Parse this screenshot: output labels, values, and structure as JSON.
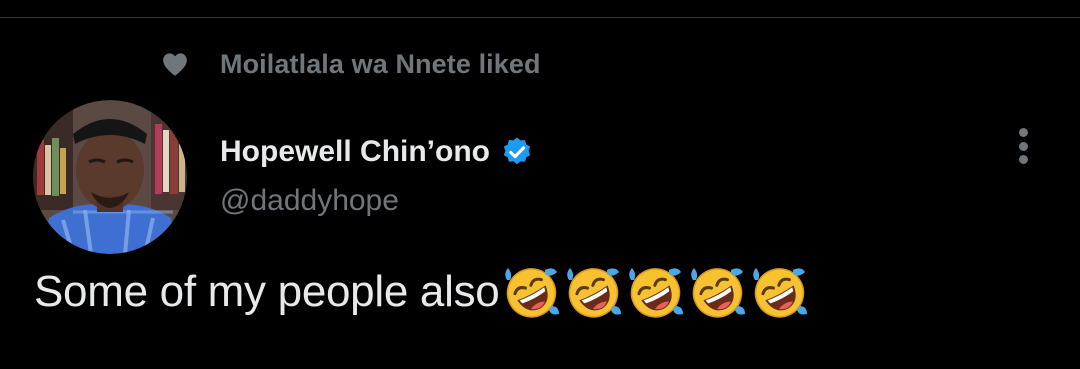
{
  "social_context": {
    "icon": "heart-icon",
    "text": "Moilatlala wa Nnete liked"
  },
  "tweet": {
    "author": {
      "display_name": "Hopewell Chin’ono",
      "handle": "@daddyhope",
      "verified": true,
      "verified_color": "#1d9bf0"
    },
    "text": "Some of my people also",
    "emojis": [
      "🤣",
      "🤣",
      "🤣",
      "🤣",
      "🤣"
    ]
  },
  "colors": {
    "background": "#000000",
    "primary_text": "#e7e9ea",
    "secondary_text": "#71767b",
    "accent": "#1d9bf0"
  }
}
